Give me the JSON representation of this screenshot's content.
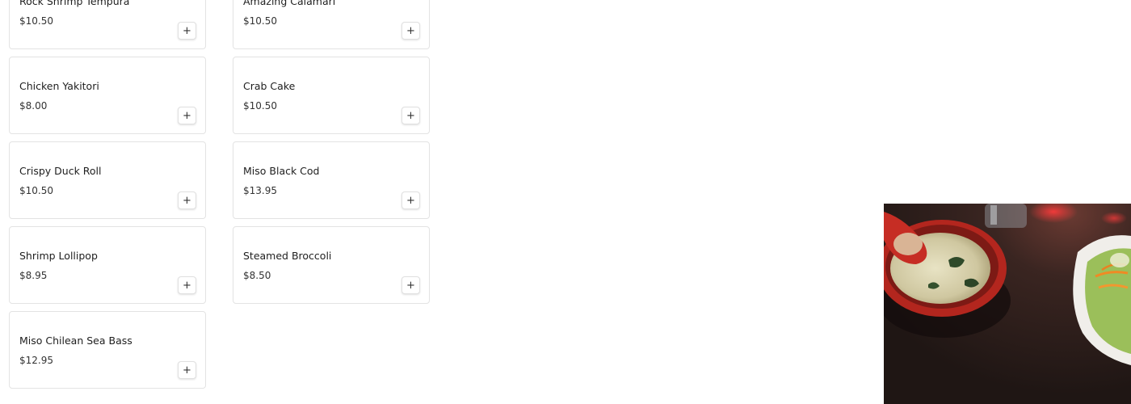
{
  "menu": {
    "items": [
      {
        "name": "Rock Shrimp Tempura",
        "price": "$10.50"
      },
      {
        "name": "Amazing Calamari",
        "price": "$10.50"
      },
      {
        "name": "Chicken Yakitori",
        "price": "$8.00"
      },
      {
        "name": "Crab Cake",
        "price": "$10.50"
      },
      {
        "name": "Crispy Duck Roll",
        "price": "$10.50"
      },
      {
        "name": "Miso Black Cod",
        "price": "$13.95"
      },
      {
        "name": "Shrimp Lollipop",
        "price": "$8.95"
      },
      {
        "name": "Steamed Broccoli",
        "price": "$8.50"
      },
      {
        "name": "Miso Chilean Sea Bass",
        "price": "$12.95"
      }
    ],
    "add_icon": "plus-icon",
    "add_symbol": "+"
  },
  "photo": {
    "subject": "miso soup and salad on a dark table"
  }
}
